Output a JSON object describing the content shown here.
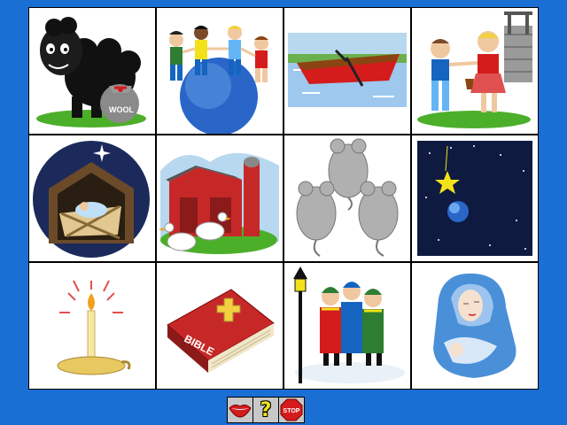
{
  "board": {
    "tiles": [
      {
        "subject": "black-sheep",
        "label": "WOOL"
      },
      {
        "subject": "children-on-globe"
      },
      {
        "subject": "rowboat"
      },
      {
        "subject": "jack-and-jill"
      },
      {
        "subject": "manger"
      },
      {
        "subject": "farm-barn"
      },
      {
        "subject": "three-mice"
      },
      {
        "subject": "star-night-sky"
      },
      {
        "subject": "candle"
      },
      {
        "subject": "bible",
        "label": "BIBLE"
      },
      {
        "subject": "carolers"
      },
      {
        "subject": "mother-and-baby"
      }
    ]
  },
  "toolbar": {
    "speak_icon": "lips-icon",
    "help_label": "?",
    "stop_label": "STOP"
  },
  "colors": {
    "background": "#1a6fd4",
    "help": "#f2e21a",
    "stop": "#d41c1c"
  }
}
